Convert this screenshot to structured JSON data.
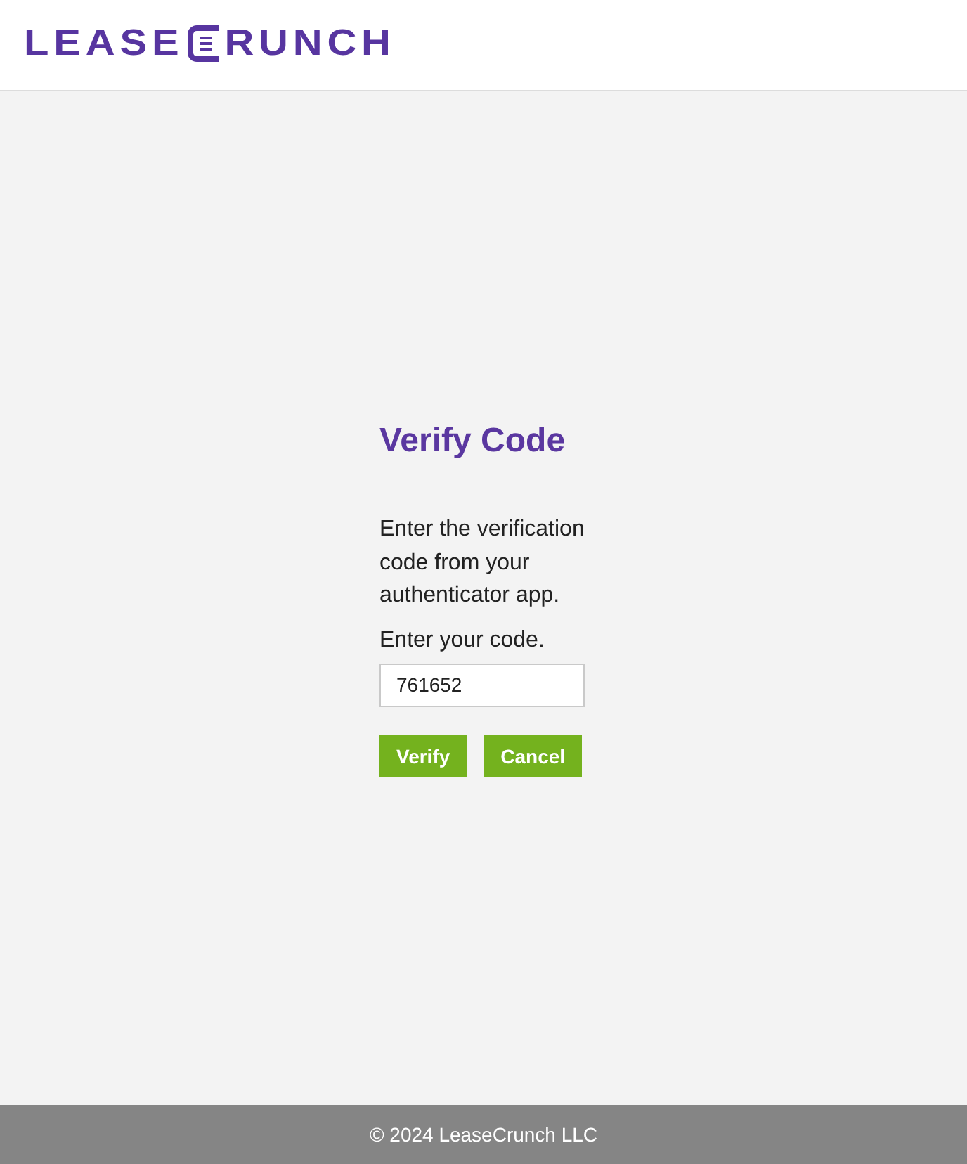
{
  "header": {
    "logo": {
      "left": "LEASE",
      "right": "RUNCH"
    }
  },
  "form": {
    "title": "Verify Code",
    "instructions": "Enter the verification code from your authenticator app.",
    "code_label": "Enter your code.",
    "code_value": "761652",
    "buttons": [
      {
        "label": "Verify"
      },
      {
        "label": "Cancel"
      }
    ]
  },
  "footer": {
    "text": "© 2024 LeaseCrunch LLC"
  }
}
